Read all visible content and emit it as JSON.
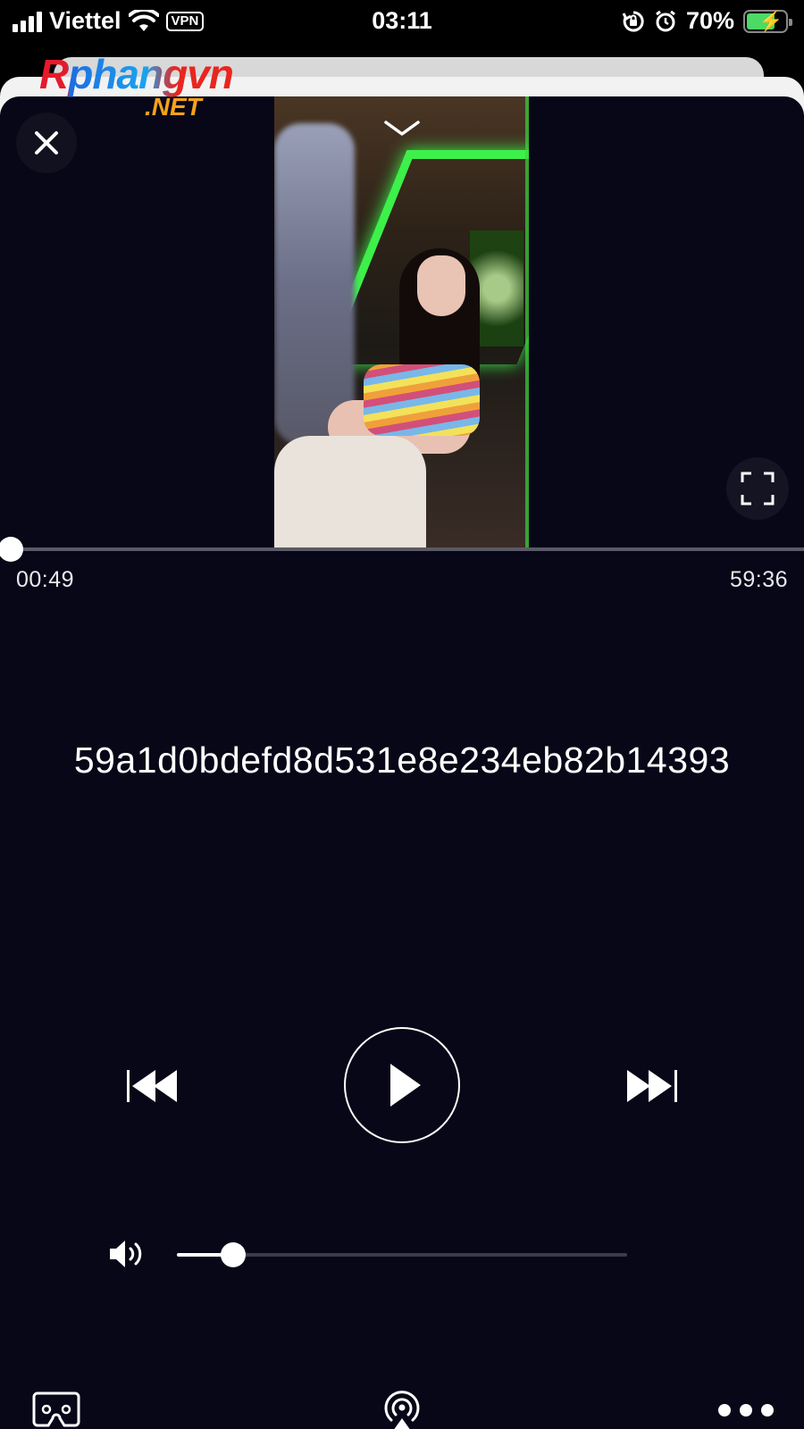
{
  "status_bar": {
    "carrier": "Viettel",
    "vpn_label": "VPN",
    "time": "03:11",
    "battery_percent": "70%",
    "battery_level": 0.7,
    "charging": true
  },
  "watermark": {
    "main": "Rphangvn",
    "sub": ".NET"
  },
  "player": {
    "title": "59a1d0bdefd8d531e8e234eb82b14393",
    "elapsed": "00:49",
    "duration": "59:36",
    "progress_fraction": 0.0137,
    "volume_fraction": 0.125,
    "state": "paused"
  },
  "icons": {
    "close": "close-icon",
    "collapse": "chevron-down-icon",
    "fullscreen": "fullscreen-icon",
    "previous": "skip-previous-icon",
    "play": "play-icon",
    "next": "skip-next-icon",
    "volume": "speaker-icon",
    "vr": "vr-headset-icon",
    "airplay": "airplay-icon",
    "more": "more-icon"
  },
  "colors": {
    "background": "#070718",
    "accent": "#ffffff",
    "track": "#5a5a66",
    "battery": "#4cd964",
    "logo_red": "#e51a2a",
    "logo_blue": "#1aa3f0",
    "logo_orange": "#f7a11a"
  }
}
